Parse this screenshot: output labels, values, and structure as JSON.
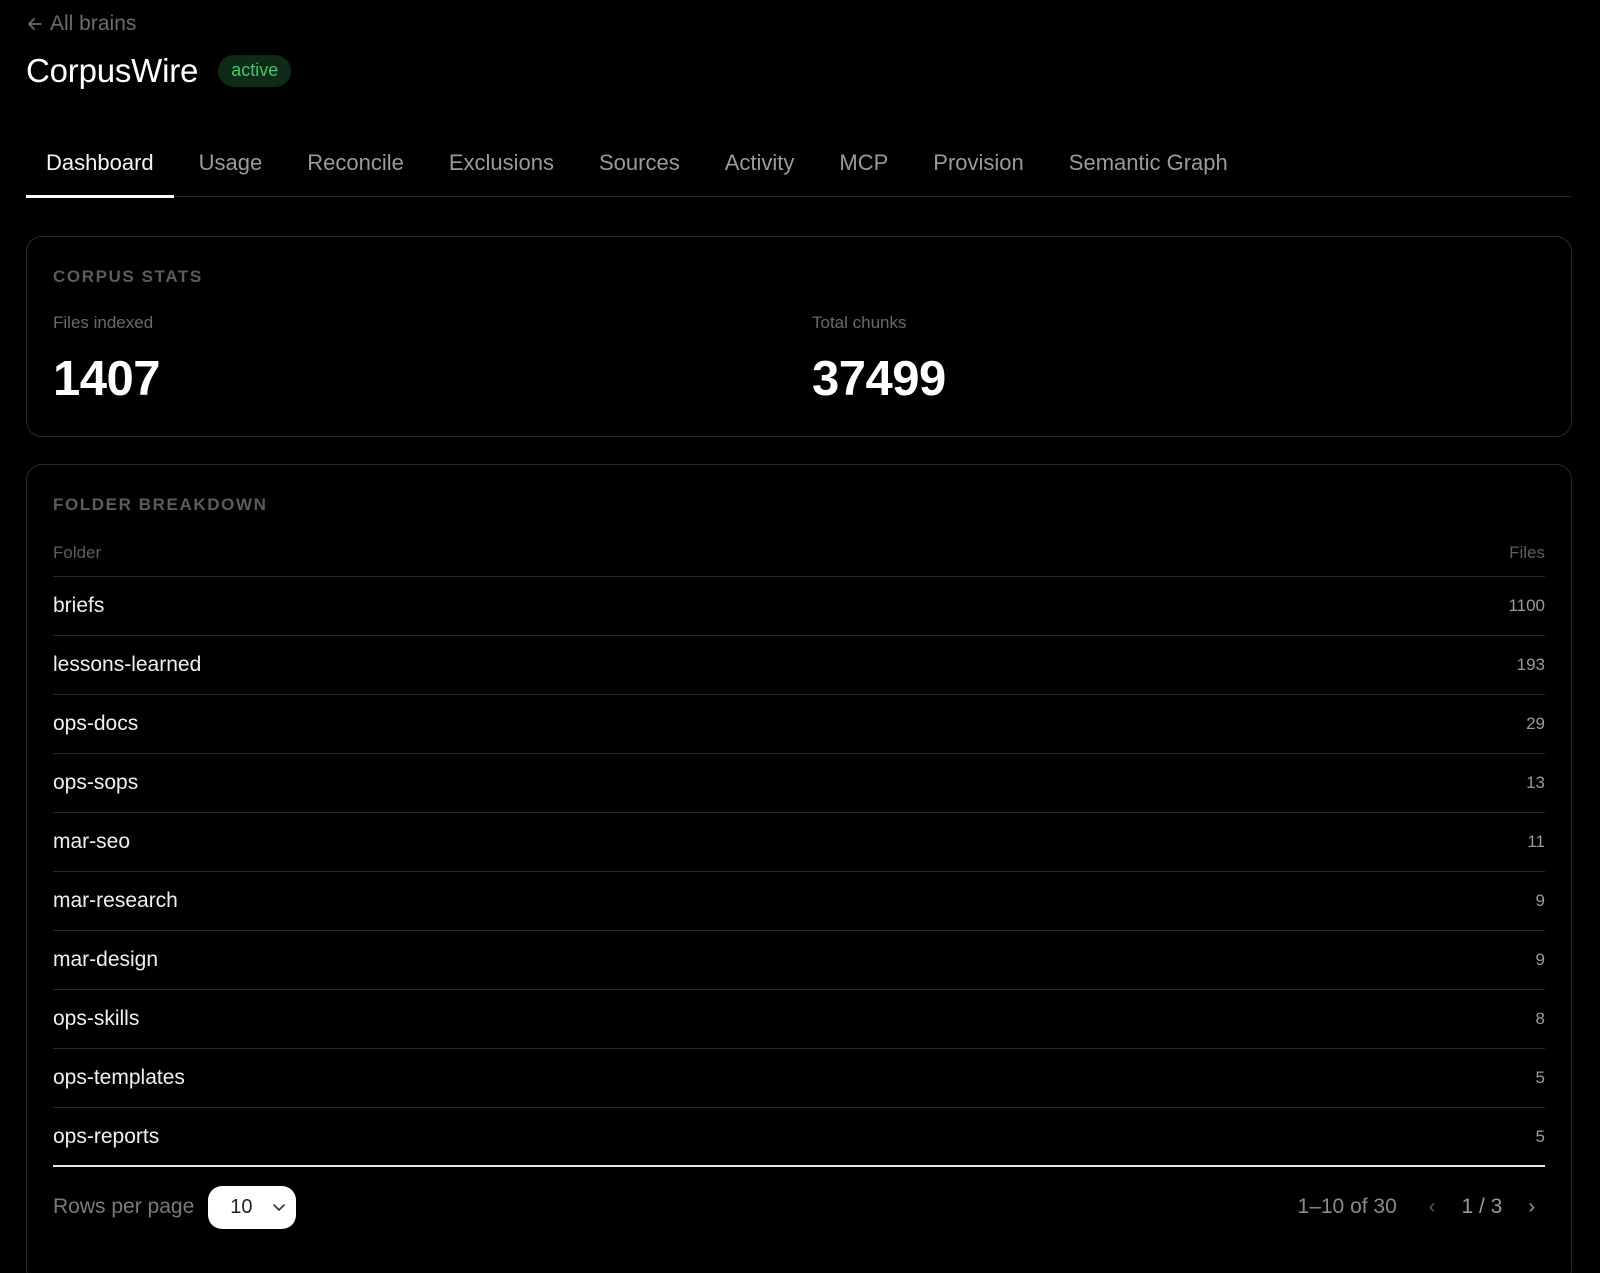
{
  "header": {
    "back_label": "All brains",
    "title": "CorpusWire",
    "status_badge": "active"
  },
  "tabs": [
    {
      "label": "Dashboard",
      "active": true
    },
    {
      "label": "Usage"
    },
    {
      "label": "Reconcile"
    },
    {
      "label": "Exclusions"
    },
    {
      "label": "Sources"
    },
    {
      "label": "Activity"
    },
    {
      "label": "MCP"
    },
    {
      "label": "Provision"
    },
    {
      "label": "Semantic Graph"
    }
  ],
  "corpus_stats": {
    "section_title": "CORPUS STATS",
    "files_indexed_label": "Files indexed",
    "files_indexed_value": "1407",
    "total_chunks_label": "Total chunks",
    "total_chunks_value": "37499"
  },
  "folder_breakdown": {
    "section_title": "FOLDER BREAKDOWN",
    "columns": {
      "folder": "Folder",
      "files": "Files"
    },
    "rows": [
      {
        "folder": "briefs",
        "files": "1100"
      },
      {
        "folder": "lessons-learned",
        "files": "193"
      },
      {
        "folder": "ops-docs",
        "files": "29"
      },
      {
        "folder": "ops-sops",
        "files": "13"
      },
      {
        "folder": "mar-seo",
        "files": "11"
      },
      {
        "folder": "mar-research",
        "files": "9"
      },
      {
        "folder": "mar-design",
        "files": "9"
      },
      {
        "folder": "ops-skills",
        "files": "8"
      },
      {
        "folder": "ops-templates",
        "files": "5"
      },
      {
        "folder": "ops-reports",
        "files": "5"
      }
    ]
  },
  "pagination": {
    "rows_per_page_label": "Rows per page",
    "rows_per_page_value": "10",
    "range_label": "1–10 of 30",
    "prev_glyph": "‹",
    "page_indicator": "1 / 3",
    "next_glyph": "›"
  },
  "colors": {
    "background": "#000000",
    "badge_text": "#3ccb6a",
    "badge_bg": "#0f2a18",
    "active_tab_underline": "#ffffff"
  }
}
